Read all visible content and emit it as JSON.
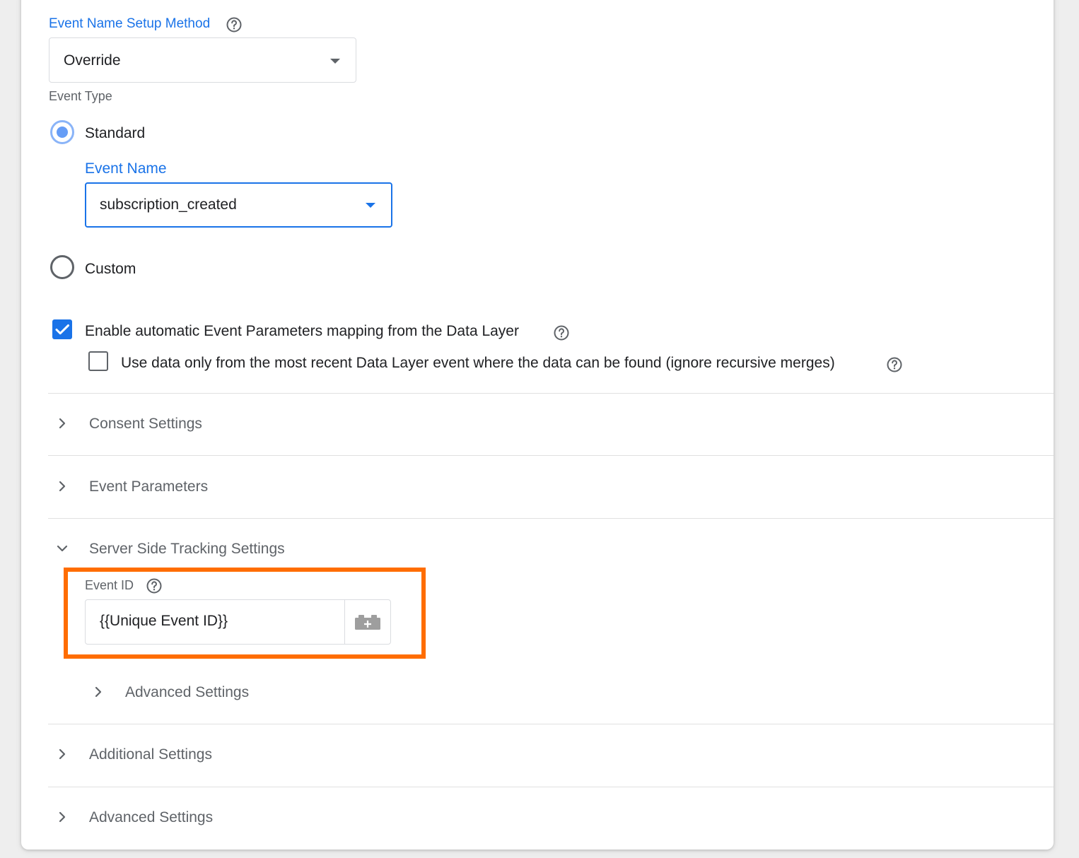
{
  "event_name_setup": {
    "label": "Event Name Setup Method",
    "selected": "Override"
  },
  "event_type": {
    "label": "Event Type",
    "standard_label": "Standard",
    "event_name_label": "Event Name",
    "event_name_value": "subscription_created",
    "custom_label": "Custom",
    "selected": "Standard"
  },
  "data_layer": {
    "enable_mapping_label": "Enable automatic Event Parameters mapping from the Data Layer",
    "enable_mapping_checked": true,
    "recent_only_label": "Use data only from the most recent Data Layer event where the data can be found (ignore recursive merges)",
    "recent_only_checked": false
  },
  "sections": {
    "consent": "Consent Settings",
    "event_parameters": "Event Parameters",
    "server_side": "Server Side Tracking Settings",
    "additional": "Additional Settings",
    "advanced": "Advanced Settings"
  },
  "server_side": {
    "event_id_label": "Event ID",
    "event_id_value": "{{Unique Event ID}}",
    "advanced_label": "Advanced Settings"
  },
  "colors": {
    "accent": "#1a73e8",
    "highlight": "#ff6d00"
  },
  "icons": {
    "help": "help-circle-icon",
    "dropdown": "caret-down-icon",
    "expand": "chevron-right-icon",
    "collapse": "chevron-down-icon",
    "variable": "add-variable-brick-icon"
  }
}
